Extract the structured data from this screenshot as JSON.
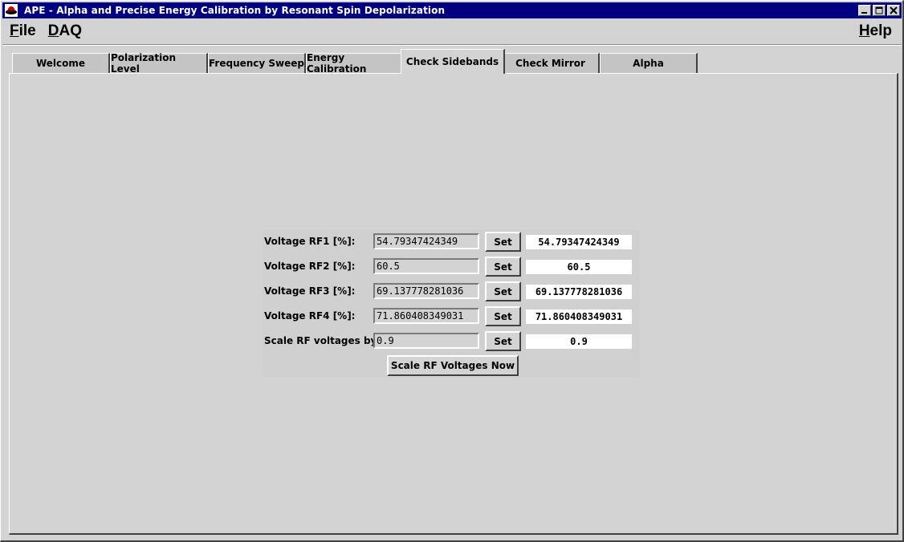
{
  "window": {
    "title": "APE - Alpha and Precise Energy Calibration by Resonant Spin Depolarization"
  },
  "menu": {
    "file": {
      "first": "F",
      "rest": "ile"
    },
    "daq": {
      "first": "D",
      "rest": "AQ"
    },
    "help": {
      "first": "H",
      "rest": "elp"
    }
  },
  "tabs": [
    {
      "label": "Welcome"
    },
    {
      "label": "Polarization Level"
    },
    {
      "label": "Frequency Sweep"
    },
    {
      "label": "Energy Calibration"
    },
    {
      "label": "Check Sidebands",
      "active": true
    },
    {
      "label": "Check Mirror"
    },
    {
      "label": "Alpha"
    }
  ],
  "form": {
    "rows": [
      {
        "label": "Voltage RF1 [%]:",
        "input": "54.79347424349",
        "set_label": "Set",
        "value": "54.79347424349"
      },
      {
        "label": "Voltage RF2 [%]:",
        "input": "60.5",
        "set_label": "Set",
        "value": "60.5"
      },
      {
        "label": "Voltage RF3 [%]:",
        "input": "69.137778281036",
        "set_label": "Set",
        "value": "69.137778281036"
      },
      {
        "label": "Voltage RF4 [%]:",
        "input": "71.860408349031",
        "set_label": "Set",
        "value": "71.860408349031"
      },
      {
        "label": "Scale RF voltages by:",
        "input": "0.9",
        "set_label": "Set",
        "value": "0.9"
      }
    ],
    "scale_now_label": "Scale RF Voltages Now"
  },
  "colors": {
    "titlebar": "#000080",
    "background": "#d3d3d3",
    "value_box": "#ffffff"
  }
}
